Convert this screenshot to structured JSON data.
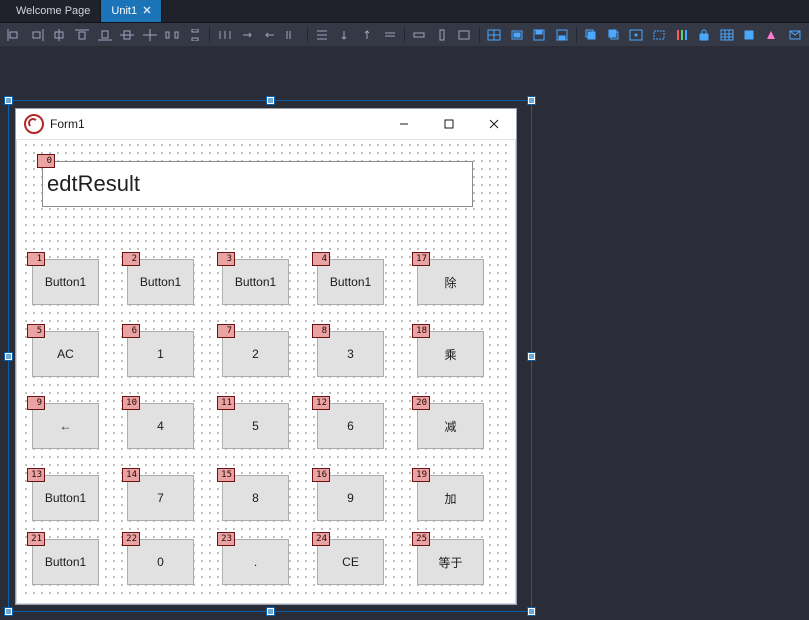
{
  "tabs": {
    "welcome": "Welcome Page",
    "unit": "Unit1"
  },
  "form": {
    "caption": "Form1",
    "edit_text": "edtResult",
    "edit_tag": "0"
  },
  "buttons": [
    {
      "tag": "1",
      "label": "Button1",
      "col": 1,
      "row": 1
    },
    {
      "tag": "2",
      "label": "Button1",
      "col": 2,
      "row": 1
    },
    {
      "tag": "3",
      "label": "Button1",
      "col": 3,
      "row": 1
    },
    {
      "tag": "4",
      "label": "Button1",
      "col": 4,
      "row": 1
    },
    {
      "tag": "17",
      "label": "除",
      "col": 5,
      "row": 1
    },
    {
      "tag": "5",
      "label": "AC",
      "col": 1,
      "row": 2
    },
    {
      "tag": "6",
      "label": "1",
      "col": 2,
      "row": 2
    },
    {
      "tag": "7",
      "label": "2",
      "col": 3,
      "row": 2
    },
    {
      "tag": "8",
      "label": "3",
      "col": 4,
      "row": 2
    },
    {
      "tag": "18",
      "label": "乘",
      "col": 5,
      "row": 2
    },
    {
      "tag": "9",
      "label": "←",
      "col": 1,
      "row": 3
    },
    {
      "tag": "10",
      "label": "4",
      "col": 2,
      "row": 3
    },
    {
      "tag": "11",
      "label": "5",
      "col": 3,
      "row": 3
    },
    {
      "tag": "12",
      "label": "6",
      "col": 4,
      "row": 3
    },
    {
      "tag": "20",
      "label": "减",
      "col": 5,
      "row": 3
    },
    {
      "tag": "13",
      "label": "Button1",
      "col": 1,
      "row": 4
    },
    {
      "tag": "14",
      "label": "7",
      "col": 2,
      "row": 4
    },
    {
      "tag": "15",
      "label": "8",
      "col": 3,
      "row": 4
    },
    {
      "tag": "16",
      "label": "9",
      "col": 4,
      "row": 4
    },
    {
      "tag": "19",
      "label": "加",
      "col": 5,
      "row": 4
    },
    {
      "tag": "21",
      "label": "Button1",
      "col": 1,
      "row": 5
    },
    {
      "tag": "22",
      "label": "0",
      "col": 2,
      "row": 5
    },
    {
      "tag": "23",
      "label": ".",
      "col": 3,
      "row": 5
    },
    {
      "tag": "24",
      "label": "CE",
      "col": 4,
      "row": 5
    },
    {
      "tag": "25",
      "label": "等于",
      "col": 5,
      "row": 5
    }
  ]
}
